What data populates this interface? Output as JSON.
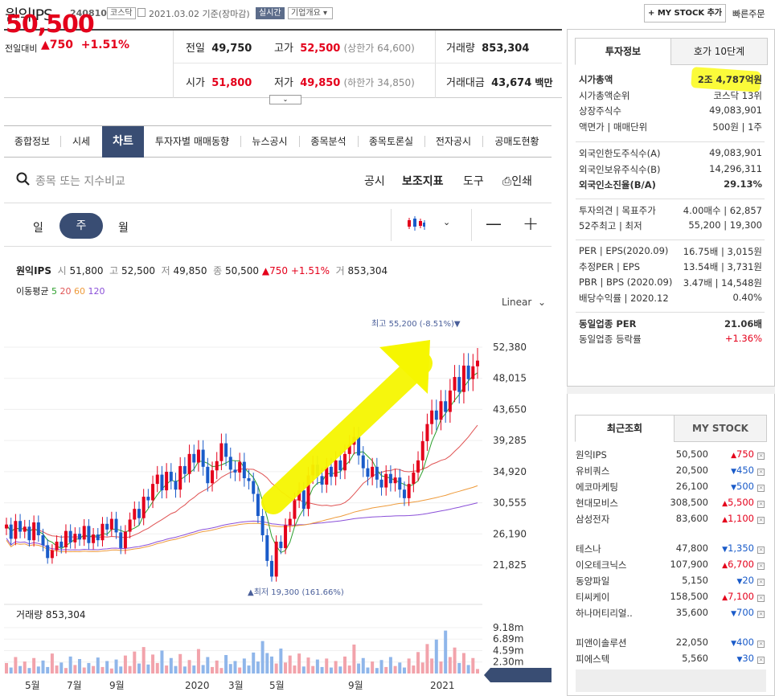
{
  "header": {
    "name": "원익IPS",
    "code": "240810",
    "market": "코스닥",
    "date": "2021.03.02 기준(장마감)",
    "realtime": "실시간",
    "company_info": "기업개요",
    "mystock_btn": "+ MY STOCK 추가",
    "fast_order": "빠른주문"
  },
  "price": {
    "current": "50,500",
    "change_label": "전일대비",
    "change_arrow": "▲",
    "change": "750",
    "change_pct": "+1.51%"
  },
  "quote": {
    "prev_label": "전일",
    "prev": "49,750",
    "high_label": "고가",
    "high": "52,500",
    "upper_limit": "(상한가 64,600)",
    "volume_label": "거래량",
    "volume": "853,304",
    "open_label": "시가",
    "open": "51,800",
    "low_label": "저가",
    "low": "49,850",
    "lower_limit": "(하한가 34,850)",
    "value_label": "거래대금",
    "value": "43,674",
    "value_unit": "백만"
  },
  "tabs": [
    "종합정보",
    "시세",
    "차트",
    "투자자별 매매동향",
    "뉴스공시",
    "종목분석",
    "종목토론실",
    "전자공시",
    "공매도현황"
  ],
  "chart_toolbar": {
    "search_placeholder": "종목 또는 지수비교",
    "notice": "공시",
    "indicators": "보조지표",
    "tools": "도구",
    "print": "인쇄",
    "day": "일",
    "week": "주",
    "month": "월",
    "scale": "Linear"
  },
  "chart_info": {
    "name": "원익IPS",
    "open_l": "시",
    "open": "51,800",
    "high_l": "고",
    "high": "52,500",
    "low_l": "저",
    "low": "49,850",
    "close_l": "종",
    "close": "50,500",
    "chg": "▲750",
    "pct": "+1.51%",
    "vol_l": "거",
    "vol": "853,304",
    "ma_label": "이동평균",
    "ma": [
      "5",
      "20",
      "60",
      "120"
    ],
    "ma_colors": [
      "#2ea02e",
      "#e05454",
      "#ee9a3a",
      "#8a4fd8"
    ]
  },
  "chart_data": {
    "type": "candlestick",
    "y_ticks": [
      "52,380",
      "48,015",
      "43,650",
      "39,285",
      "34,920",
      "30,555",
      "26,190",
      "21,825"
    ],
    "x_ticks": [
      "5월",
      "7월",
      "9월",
      "2020",
      "3월",
      "5월",
      "9월",
      "2021"
    ],
    "current_label": "50,500",
    "high_marker": "최고 55,200 (-8.51%)▼",
    "low_marker": "▲최저 19,300 (161.66%)",
    "volume_title": "거래량 853,304",
    "volume_ticks": [
      "9.18m",
      "6.89m",
      "4.59m",
      "2.30m"
    ],
    "close_values": [
      27500,
      25500,
      28000,
      26500,
      27200,
      25300,
      27800,
      26000,
      24600,
      22800,
      23900,
      25100,
      24300,
      26600,
      25000,
      26200,
      25400,
      27300,
      24900,
      26100,
      25300,
      27600,
      26800,
      28300,
      26400,
      24200,
      26500,
      28200,
      29700,
      28400,
      31400,
      30900,
      33200,
      34500,
      32300,
      34900,
      33600,
      32400,
      35700,
      34600,
      37400,
      36200,
      38000,
      35600,
      33300,
      35100,
      36400,
      38900,
      37000,
      35200,
      34800,
      36300,
      34000,
      33600,
      31800,
      28700,
      26000,
      22400,
      20200,
      25100,
      24200,
      27400,
      28300,
      30900,
      32300,
      29700,
      34400,
      35900,
      34300,
      33100,
      35600,
      34200,
      36500,
      35100,
      37400,
      38700,
      39800,
      37200,
      35400,
      34200,
      35600,
      33800,
      32700,
      34600,
      33300,
      34100,
      32400,
      31200,
      33200,
      34800,
      36500,
      39200,
      41600,
      43500,
      42200,
      44800,
      43300,
      46300,
      48200,
      46100,
      49800,
      47900,
      49700,
      50500
    ],
    "volume_values": [
      2.1,
      1.2,
      3.3,
      1.5,
      2.4,
      1.1,
      3.1,
      1.4,
      2.6,
      1.3,
      4.0,
      1.6,
      2.2,
      1.1,
      3.4,
      1.7,
      2.9,
      1.2,
      2.1,
      1.5,
      3.2,
      1.3,
      2.5,
      1.0,
      2.8,
      1.4,
      3.6,
      1.5,
      4.4,
      2.0,
      5.3,
      1.8,
      3.8,
      2.1,
      4.6,
      1.6,
      3.1,
      1.5,
      3.9,
      1.4,
      2.7,
      1.6,
      4.9,
      1.7,
      3.3,
      1.3,
      2.6,
      1.1,
      3.7,
      1.9,
      2.5,
      1.2,
      3.0,
      1.6,
      4.2,
      2.4,
      6.5,
      4.1,
      3.4,
      2.0,
      5.0,
      2.2,
      3.6,
      1.6,
      4.0,
      1.4,
      3.2,
      1.5,
      2.8,
      1.3,
      3.0,
      1.2,
      2.5,
      1.4,
      3.4,
      1.6,
      5.8,
      2.0,
      3.1,
      1.2,
      2.4,
      1.1,
      2.7,
      1.3,
      3.3,
      1.5,
      2.2,
      1.2,
      3.0,
      1.6,
      4.3,
      2.2,
      5.9,
      3.0,
      6.8,
      2.4,
      8.6,
      3.3,
      5.2,
      2.1,
      4.1,
      1.7,
      3.1,
      0.9
    ]
  },
  "side_tabs": {
    "invest": "투자정보",
    "hoga": "호가 10단계"
  },
  "invest_info": {
    "rows1": [
      [
        "시가총액",
        "2조 4,787억원"
      ],
      [
        "시가총액순위",
        "코스닥 13위"
      ],
      [
        "상장주식수",
        "49,083,901"
      ],
      [
        "액면가 | 매매단위",
        "500원 | 1주"
      ]
    ],
    "rows2": [
      [
        "외국인한도주식수(A)",
        "49,083,901"
      ],
      [
        "외국인보유주식수(B)",
        "14,296,311"
      ],
      [
        "외국인소진율(B/A)",
        "29.13%"
      ]
    ],
    "rows3": [
      [
        "투자의견 | 목표주가",
        "4.00매수 | 62,857"
      ],
      [
        "52주최고 | 최저",
        "55,200 | 19,300"
      ]
    ],
    "rows4": [
      [
        "PER | EPS(2020.09)",
        "16.75배 | 3,015원"
      ],
      [
        "추정PER | EPS",
        "13.54배 | 3,731원"
      ],
      [
        "PBR | BPS (2020.09)",
        "3.47배 | 14,548원"
      ],
      [
        "배당수익률 | 2020.12",
        "0.40%"
      ]
    ],
    "rows5": [
      [
        "동일업종 PER",
        "21.06배"
      ],
      [
        "동일업종 등락률",
        "+1.36%"
      ]
    ]
  },
  "recent_tabs": {
    "recent": "최근조회",
    "mystock": "MY STOCK"
  },
  "recent_list": [
    {
      "name": "원익IPS",
      "price": "50,500",
      "chg": "750",
      "dir": "up"
    },
    {
      "name": "유비쿼스",
      "price": "20,500",
      "chg": "450",
      "dir": "down"
    },
    {
      "name": "에코마케팅",
      "price": "26,100",
      "chg": "500",
      "dir": "down"
    },
    {
      "name": "현대모비스",
      "price": "308,500",
      "chg": "5,500",
      "dir": "up"
    },
    {
      "name": "삼성전자",
      "price": "83,600",
      "chg": "1,100",
      "dir": "up"
    },
    {
      "name": "테스나",
      "price": "47,800",
      "chg": "1,350",
      "dir": "down"
    },
    {
      "name": "이오테크닉스",
      "price": "107,900",
      "chg": "6,700",
      "dir": "up"
    },
    {
      "name": "동양파일",
      "price": "5,150",
      "chg": "20",
      "dir": "down"
    },
    {
      "name": "티씨케이",
      "price": "158,500",
      "chg": "7,100",
      "dir": "up"
    },
    {
      "name": "하나머티리얼..",
      "price": "35,600",
      "chg": "700",
      "dir": "down"
    },
    {
      "name": "피앤이솔루션",
      "price": "22,050",
      "chg": "400",
      "dir": "down"
    },
    {
      "name": "피에스텍",
      "price": "5,560",
      "chg": "30",
      "dir": "down"
    }
  ]
}
